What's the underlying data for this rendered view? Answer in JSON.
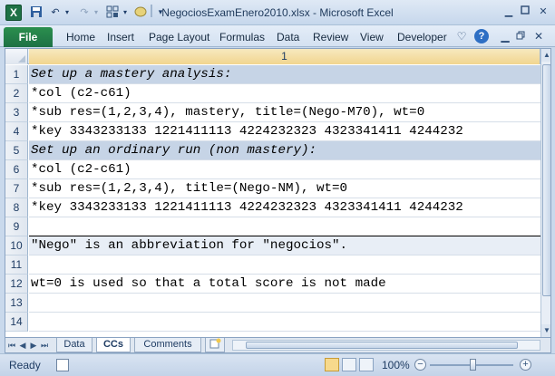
{
  "window": {
    "title": "NegociosExamEnero2010.xlsx  -  Microsoft Excel"
  },
  "ribbon": {
    "file_label": "File",
    "tabs": [
      "Home",
      "Insert",
      "Page Layout",
      "Formulas",
      "Data",
      "Review",
      "View",
      "Developer"
    ]
  },
  "sheet": {
    "column_header": "1",
    "rows": [
      {
        "num": "1",
        "text": "Set up a mastery analysis:",
        "style": "header"
      },
      {
        "num": "2",
        "text": "*col (c2-c61)",
        "style": "plain"
      },
      {
        "num": "3",
        "text": "*sub res=(1,2,3,4), mastery, title=(Nego-M70), wt=0",
        "style": "plain"
      },
      {
        "num": "4",
        "text": "*key 3343233133 1221411113 4224232323 4323341411 4244232",
        "style": "plain"
      },
      {
        "num": "5",
        "text": "Set up an ordinary run (non mastery):",
        "style": "header"
      },
      {
        "num": "6",
        "text": "*col (c2-c61)",
        "style": "plain"
      },
      {
        "num": "7",
        "text": "*sub res=(1,2,3,4), title=(Nego-NM), wt=0",
        "style": "plain"
      },
      {
        "num": "8",
        "text": "*key 3343233133 1221411113 4224232323 4323341411 4244232",
        "style": "plain"
      },
      {
        "num": "9",
        "text": "",
        "style": "thick"
      },
      {
        "num": "10",
        "text": "\"Nego\" is an abbreviation for \"negocios\".",
        "style": "note"
      },
      {
        "num": "11",
        "text": "",
        "style": "plain"
      },
      {
        "num": "12",
        "text": "wt=0 is used so that a total score is not made",
        "style": "plain"
      },
      {
        "num": "13",
        "text": "",
        "style": "plain"
      },
      {
        "num": "14",
        "text": "",
        "style": "plain"
      }
    ]
  },
  "sheet_tabs": [
    "Data",
    "CCs",
    "Comments"
  ],
  "active_sheet": "CCs",
  "status": {
    "ready": "Ready",
    "zoom": "100%"
  },
  "colors": {
    "header_fill": "#c6d4e6",
    "note_fill": "#e8eef6",
    "file_tab": "#1e7145"
  }
}
